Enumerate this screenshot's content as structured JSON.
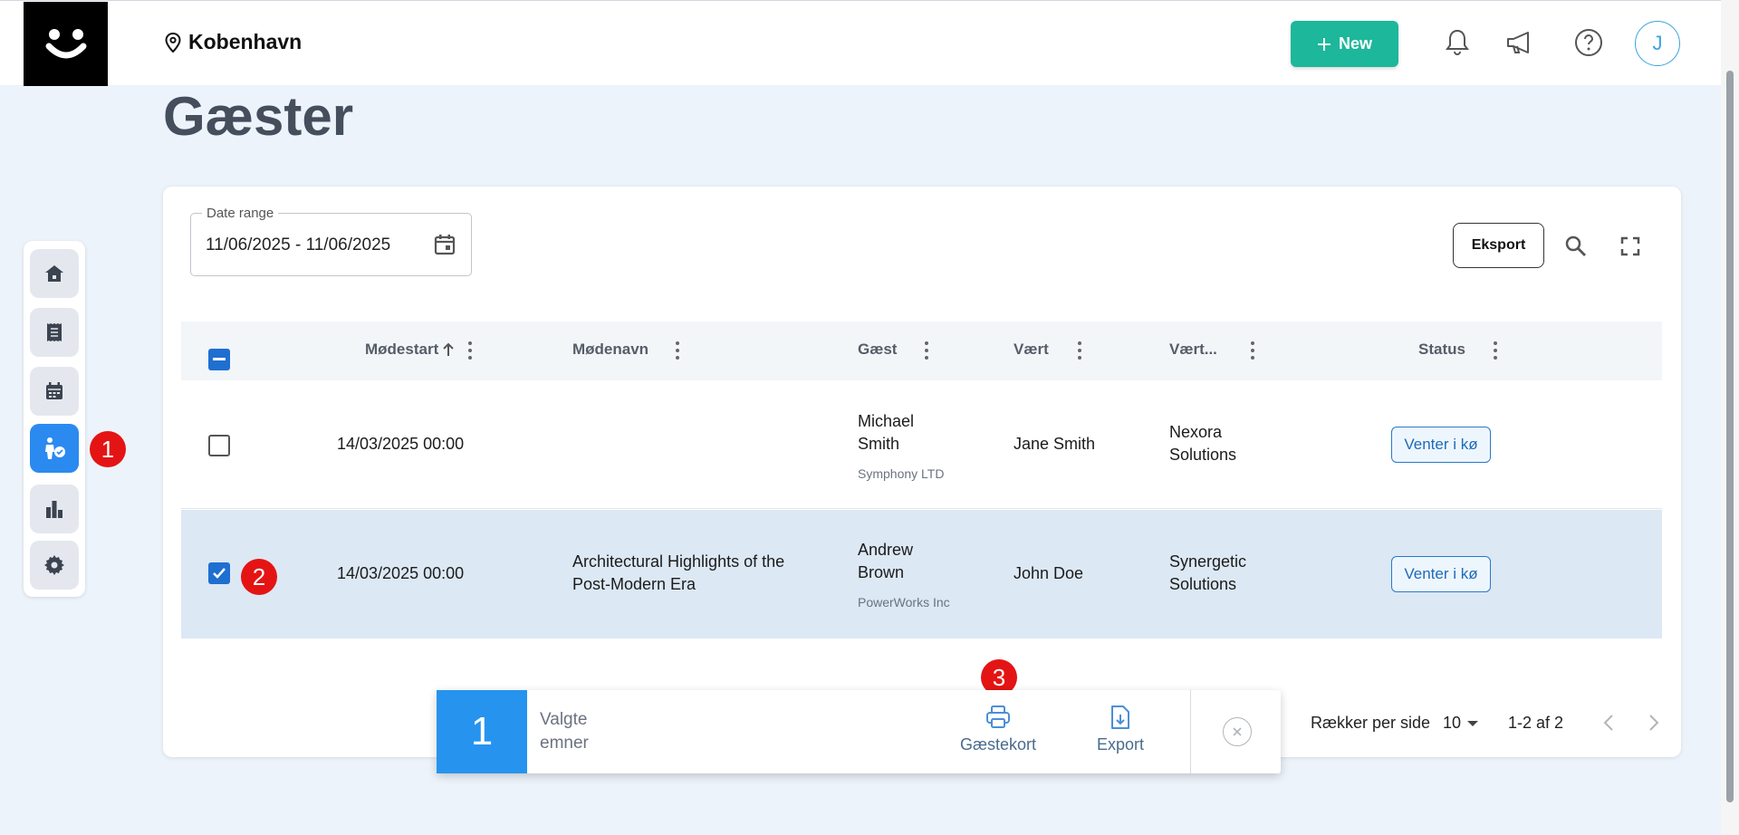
{
  "header": {
    "location": "Kobenhavn",
    "new_label": "New",
    "avatar_initial": "J"
  },
  "page": {
    "title": "Gæster"
  },
  "filters": {
    "date_range_label": "Date range",
    "date_range_value": "11/06/2025 - 11/06/2025"
  },
  "toolbar": {
    "export_label": "Eksport"
  },
  "table": {
    "columns": [
      "Mødestart",
      "Mødenavn",
      "Gæst",
      "Vært",
      "Vært...",
      "Status"
    ],
    "rows": [
      {
        "start": "14/03/2025 00:00",
        "meeting": "",
        "guest_first": "Michael",
        "guest_last": "Smith",
        "guest_company": "Symphony LTD",
        "host": "Jane Smith",
        "host_company_1": "Nexora",
        "host_company_2": "Solutions",
        "status": "Venter i kø",
        "selected": false
      },
      {
        "start": "14/03/2025 00:00",
        "meeting_1": "Architectural Highlights of the",
        "meeting_2": "Post-Modern Era",
        "guest_first": "Andrew",
        "guest_last": "Brown",
        "guest_company": "PowerWorks Inc",
        "host": "John Doe",
        "host_company_1": "Synergetic",
        "host_company_2": "Solutions",
        "status": "Venter i kø",
        "selected": true
      }
    ]
  },
  "pagination": {
    "rows_per_page_label": "Rækker per side",
    "rows_per_page_value": "10",
    "range": "1-2 af 2"
  },
  "selection_bar": {
    "count": "1",
    "label_1": "Valgte",
    "label_2": "emner",
    "guest_card_label": "Gæstekort",
    "export_label": "Export"
  },
  "markers": [
    "1",
    "2",
    "3"
  ],
  "colors": {
    "accent_green": "#1db79b",
    "accent_blue": "#2694ef",
    "marker_red": "#e41414",
    "selected_row": "#dce8f4"
  },
  "icons": {
    "sidebar": [
      "home-icon",
      "receipt-icon",
      "calendar-icon",
      "guest-check-icon",
      "bar-chart-icon",
      "gear-icon"
    ],
    "header": [
      "location-pin-icon",
      "plus-icon",
      "bell-icon",
      "megaphone-icon",
      "help-icon"
    ],
    "toolbar": [
      "search-icon",
      "fullscreen-icon"
    ]
  }
}
